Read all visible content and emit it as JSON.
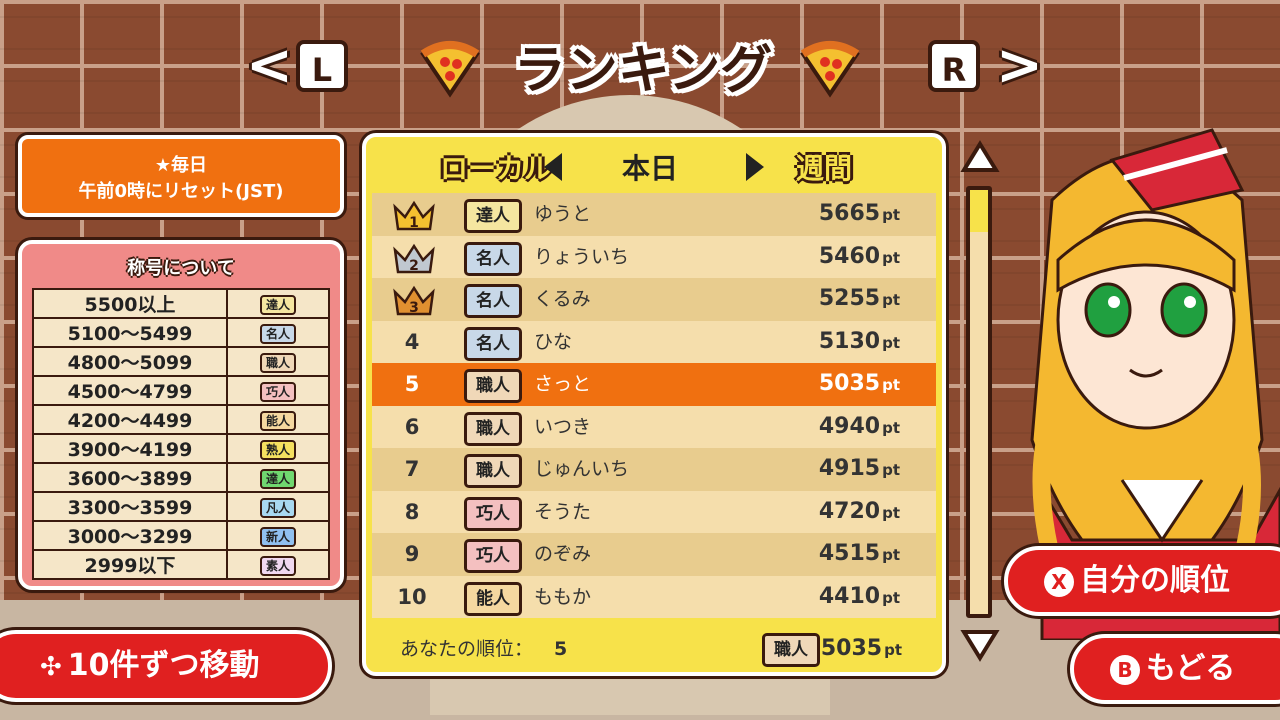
{
  "header": {
    "title": "ランキング",
    "left_button": "L",
    "right_button": "R"
  },
  "reset_info": {
    "line1": "★毎日",
    "line2": "午前0時にリセット(JST)"
  },
  "title_legend": {
    "heading": "称号について",
    "rows": [
      {
        "range": "5500以上",
        "title": "達人",
        "color": "#f5e6a0"
      },
      {
        "range": "5100〜5499",
        "title": "名人",
        "color": "#c8d8e8"
      },
      {
        "range": "4800〜5099",
        "title": "職人",
        "color": "#f0d8b8"
      },
      {
        "range": "4500〜4799",
        "title": "巧人",
        "color": "#f4c0c0"
      },
      {
        "range": "4200〜4499",
        "title": "能人",
        "color": "#f5d8a0"
      },
      {
        "range": "3900〜4199",
        "title": "熟人",
        "color": "#f5e060"
      },
      {
        "range": "3600〜3899",
        "title": "達人",
        "color": "#70d870"
      },
      {
        "range": "3300〜3599",
        "title": "凡人",
        "color": "#a8d8f0"
      },
      {
        "range": "3000〜3299",
        "title": "新人",
        "color": "#90c0f0"
      },
      {
        "range": "2999以下",
        "title": "素人",
        "color": "#f0d8f0"
      }
    ]
  },
  "board": {
    "tab_left": "ローカル",
    "tab_center": "本日",
    "tab_right": "週間",
    "unit": "pt",
    "rows": [
      {
        "rank": "1",
        "crown": "gold",
        "title": "達人",
        "badge_color": "#f5e6a0",
        "name": "ゆうと",
        "score": "5665"
      },
      {
        "rank": "2",
        "crown": "silver",
        "title": "名人",
        "badge_color": "#c8d8e8",
        "name": "りょういち",
        "score": "5460"
      },
      {
        "rank": "3",
        "crown": "bronze",
        "title": "名人",
        "badge_color": "#c8d8e8",
        "name": "くるみ",
        "score": "5255"
      },
      {
        "rank": "4",
        "crown": "",
        "title": "名人",
        "badge_color": "#c8d8e8",
        "name": "ひな",
        "score": "5130"
      },
      {
        "rank": "5",
        "crown": "",
        "title": "職人",
        "badge_color": "#f0d8b8",
        "name": "さっと",
        "score": "5035",
        "highlight": true
      },
      {
        "rank": "6",
        "crown": "",
        "title": "職人",
        "badge_color": "#f0d8b8",
        "name": "いつき",
        "score": "4940"
      },
      {
        "rank": "7",
        "crown": "",
        "title": "職人",
        "badge_color": "#f0d8b8",
        "name": "じゅんいち",
        "score": "4915"
      },
      {
        "rank": "8",
        "crown": "",
        "title": "巧人",
        "badge_color": "#f4c0c0",
        "name": "そうた",
        "score": "4720"
      },
      {
        "rank": "9",
        "crown": "",
        "title": "巧人",
        "badge_color": "#f4c0c0",
        "name": "のぞみ",
        "score": "4515"
      },
      {
        "rank": "10",
        "crown": "",
        "title": "能人",
        "badge_color": "#f5d8a0",
        "name": "ももか",
        "score": "4410"
      }
    ],
    "my_rank_label": "あなたの順位：",
    "my_rank": "5",
    "my_title": "職人",
    "my_score": "5035"
  },
  "scroll": {
    "position": 0.1
  },
  "buttons": {
    "move": "10件ずつ移動",
    "my_rank": "自分の順位",
    "my_rank_key": "X",
    "back": "もどる",
    "back_key": "B"
  }
}
